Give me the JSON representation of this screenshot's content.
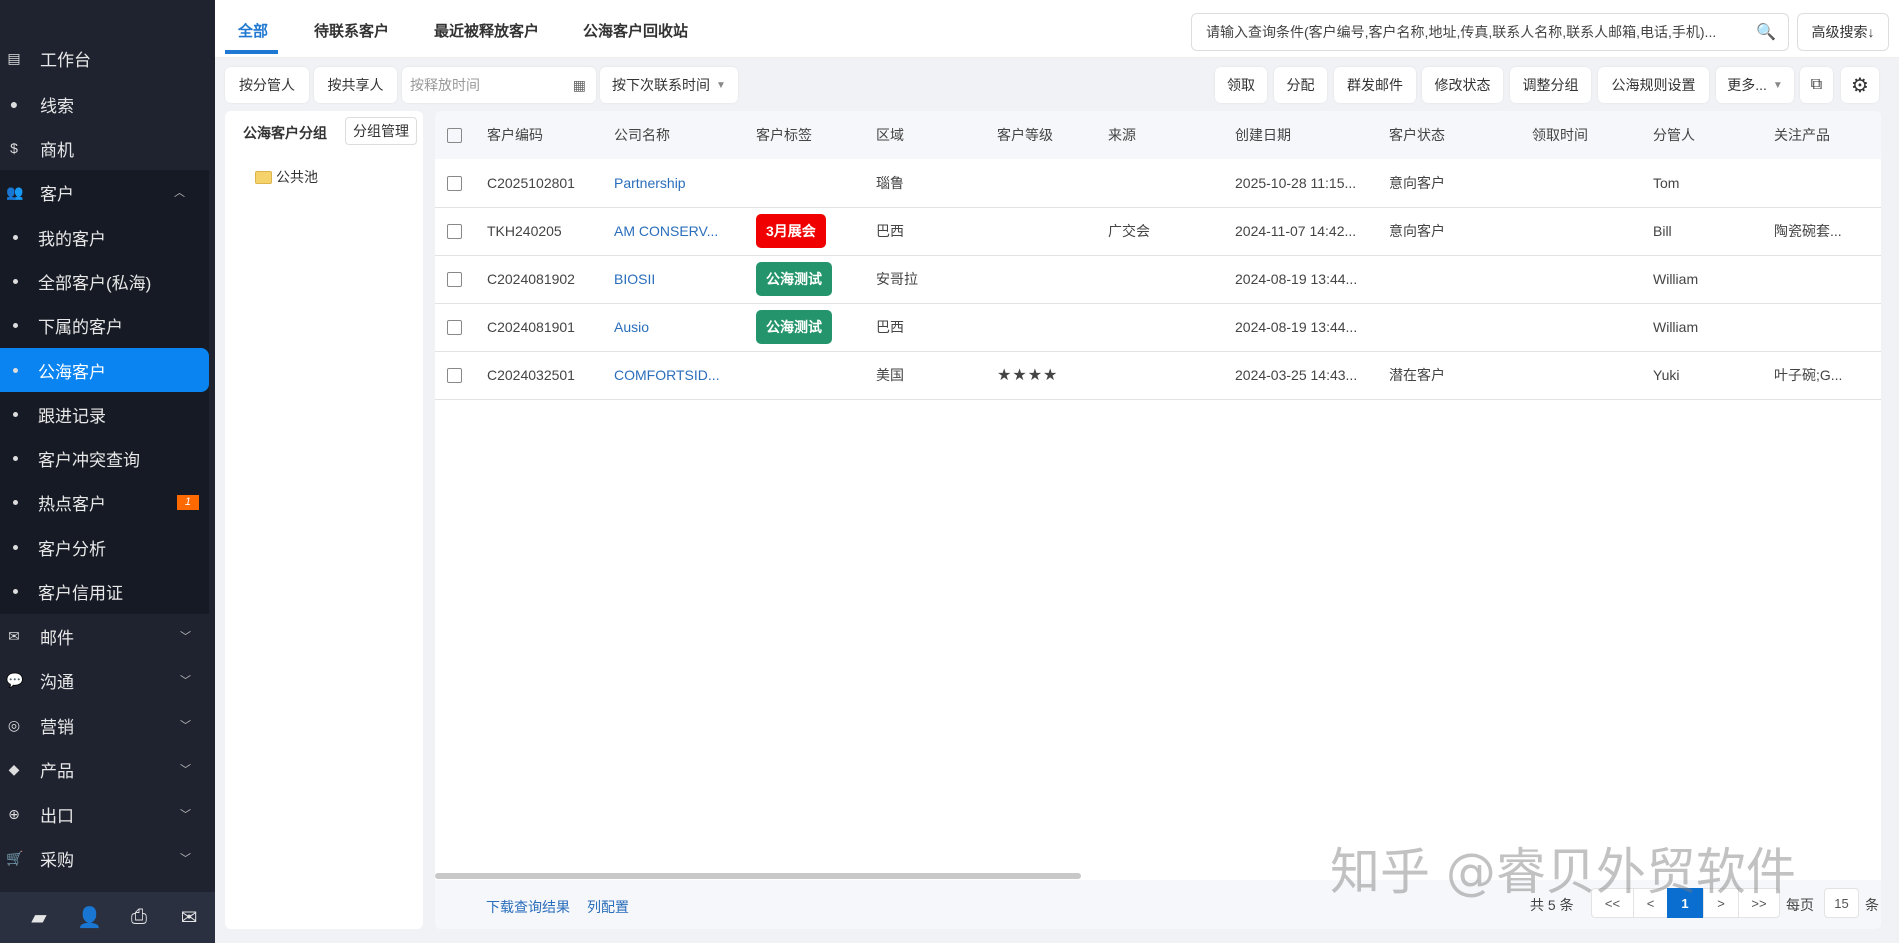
{
  "sidebar": {
    "items": [
      {
        "label": "工作台",
        "icon": "chart-icon"
      },
      {
        "label": "线索",
        "icon": "clue-icon"
      },
      {
        "label": "商机",
        "icon": "dollar-icon"
      },
      {
        "label": "客户",
        "icon": "users-icon"
      }
    ],
    "sub_items": [
      {
        "label": "我的客户"
      },
      {
        "label": "全部客户(私海)"
      },
      {
        "label": "下属的客户"
      },
      {
        "label": "公海客户",
        "active": true
      },
      {
        "label": "跟进记录"
      },
      {
        "label": "客户冲突查询"
      },
      {
        "label": "热点客户",
        "badge": "1"
      },
      {
        "label": "客户分析"
      },
      {
        "label": "客户信用证"
      }
    ],
    "groups": [
      {
        "label": "邮件",
        "icon": "mail-icon"
      },
      {
        "label": "沟通",
        "icon": "chat-icon"
      },
      {
        "label": "营销",
        "icon": "target-icon"
      },
      {
        "label": "产品",
        "icon": "box-icon"
      },
      {
        "label": "出口",
        "icon": "globe-icon"
      },
      {
        "label": "采购",
        "icon": "cart-icon"
      }
    ],
    "bottom_icons": [
      "comments-icon",
      "add-user-icon",
      "inbox-icon",
      "compose-mail-icon"
    ]
  },
  "tabs": [
    "全部",
    "待联系客户",
    "最近被释放客户",
    "公海客户回收站"
  ],
  "search": {
    "placeholder": "请输入查询条件(客户编号,客户名称,地址,传真,联系人名称,联系人邮箱,电话,手机)...",
    "advanced": "高级搜索↓"
  },
  "filters": {
    "by_manager": "按分管人",
    "by_sharer": "按共享人",
    "release_time_placeholder": "按释放时间",
    "next_contact": "按下次联系时间"
  },
  "actions": [
    "领取",
    "分配",
    "群发邮件",
    "修改状态",
    "调整分组",
    "公海规则设置",
    "更多..."
  ],
  "left_panel": {
    "title": "公海客户分组",
    "manage": "分组管理",
    "groups": [
      "公共池"
    ]
  },
  "table": {
    "columns": [
      "客户编码",
      "公司名称",
      "客户标签",
      "区域",
      "客户等级",
      "来源",
      "创建日期",
      "客户状态",
      "领取时间",
      "分管人",
      "关注产品"
    ],
    "rows": [
      {
        "code": "C2025102801",
        "company": "Partnership",
        "tag": "",
        "region": "瑙鲁",
        "level": "",
        "source": "",
        "created": "2025-10-28 11:15...",
        "status": "意向客户",
        "claimed": "",
        "manager": "Tom",
        "product": ""
      },
      {
        "code": "TKH240205",
        "company": "AM CONSERV...",
        "tag": "3月展会",
        "tag_color": "#f00000",
        "region": "巴西",
        "level": "",
        "source": "广交会",
        "created": "2024-11-07 14:42...",
        "status": "意向客户",
        "claimed": "",
        "manager": "Bill",
        "product": "陶瓷碗套..."
      },
      {
        "code": "C2024081902",
        "company": "BIOSII",
        "tag": "公海测试",
        "tag_color": "#23946b",
        "region": "安哥拉",
        "level": "",
        "source": "",
        "created": "2024-08-19 13:44...",
        "status": "",
        "claimed": "",
        "manager": "William",
        "product": ""
      },
      {
        "code": "C2024081901",
        "company": "Ausio",
        "tag": "公海测试",
        "tag_color": "#23946b",
        "region": "巴西",
        "level": "",
        "source": "",
        "created": "2024-08-19 13:44...",
        "status": "",
        "claimed": "",
        "manager": "William",
        "product": ""
      },
      {
        "code": "C2024032501",
        "company": "COMFORTSID...",
        "tag": "",
        "region": "美国",
        "level": "★★★★",
        "source": "",
        "created": "2024-03-25 14:43...",
        "status": "潜在客户",
        "claimed": "",
        "manager": "Yuki",
        "product": "叶子碗;G..."
      }
    ]
  },
  "footer": {
    "download": "下载查询结果",
    "columns_config": "列配置",
    "total_prefix": "共",
    "total": "5",
    "total_suffix": "条",
    "first": "<<",
    "prev": "<",
    "page": "1",
    "next": ">",
    "last": ">>",
    "per_page_label": "每页",
    "per_page": "15",
    "per_page_suffix": "条"
  },
  "watermark": "知乎 @睿贝外贸软件"
}
